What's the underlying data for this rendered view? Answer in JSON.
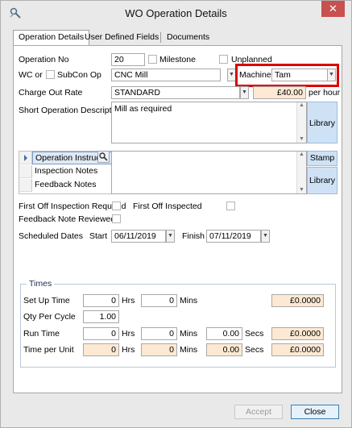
{
  "window": {
    "title": "WO Operation Details",
    "close_glyph": "✕"
  },
  "tabs": [
    {
      "label": "Operation Details",
      "active": true
    },
    {
      "label": "User Defined Fields",
      "active": false
    },
    {
      "label": "Documents",
      "active": false
    }
  ],
  "form": {
    "operation_no_label": "Operation No",
    "operation_no_value": "20",
    "milestone_label": "Milestone",
    "unplanned_label": "Unplanned",
    "wc_or_label": "WC or",
    "subcon_op_label": "SubCon Op",
    "work_centre_value": "CNC Mill",
    "machine_label": "Machine",
    "machine_value": "Tam",
    "charge_out_rate_label": "Charge Out Rate",
    "charge_out_rate_value": "STANDARD",
    "charge_amount": "£40.00",
    "per_hour_label": "per hour",
    "short_description_label": "Short Operation Description",
    "short_description_value": "Mill as required",
    "library_label": "Library",
    "notes_grid": [
      {
        "label": "Operation Instruc...",
        "selected": true
      },
      {
        "label": "Inspection Notes",
        "selected": false
      },
      {
        "label": "Feedback Notes",
        "selected": false
      }
    ],
    "stamp_label": "Stamp",
    "notes_library_label": "Library",
    "first_off_required_label": "First Off Inspection Required",
    "first_off_inspected_label": "First Off Inspected",
    "feedback_reviewed_label": "Feedback Note Reviewed",
    "scheduled_dates_label": "Scheduled Dates",
    "start_label": "Start",
    "start_date": "06/11/2019",
    "finish_label": "Finish",
    "finish_date": "07/11/2019"
  },
  "times": {
    "group_title": "Times",
    "hrs_label": "Hrs",
    "mins_label": "Mins",
    "secs_label": "Secs",
    "set_up_time_label": "Set Up Time",
    "set_up_hrs": "0",
    "set_up_mins": "0",
    "set_up_cost": "£0.0000",
    "qty_per_cycle_label": "Qty Per Cycle",
    "qty_per_cycle_value": "1.00",
    "run_time_label": "Run Time",
    "run_hrs": "0",
    "run_mins": "0",
    "run_secs": "0.00",
    "run_cost": "£0.0000",
    "time_per_unit_label": "Time per Unit",
    "unit_hrs": "0",
    "unit_mins": "0",
    "unit_secs": "0.00",
    "unit_cost": "£0.0000"
  },
  "footer": {
    "accept_label": "Accept",
    "close_label": "Close"
  }
}
